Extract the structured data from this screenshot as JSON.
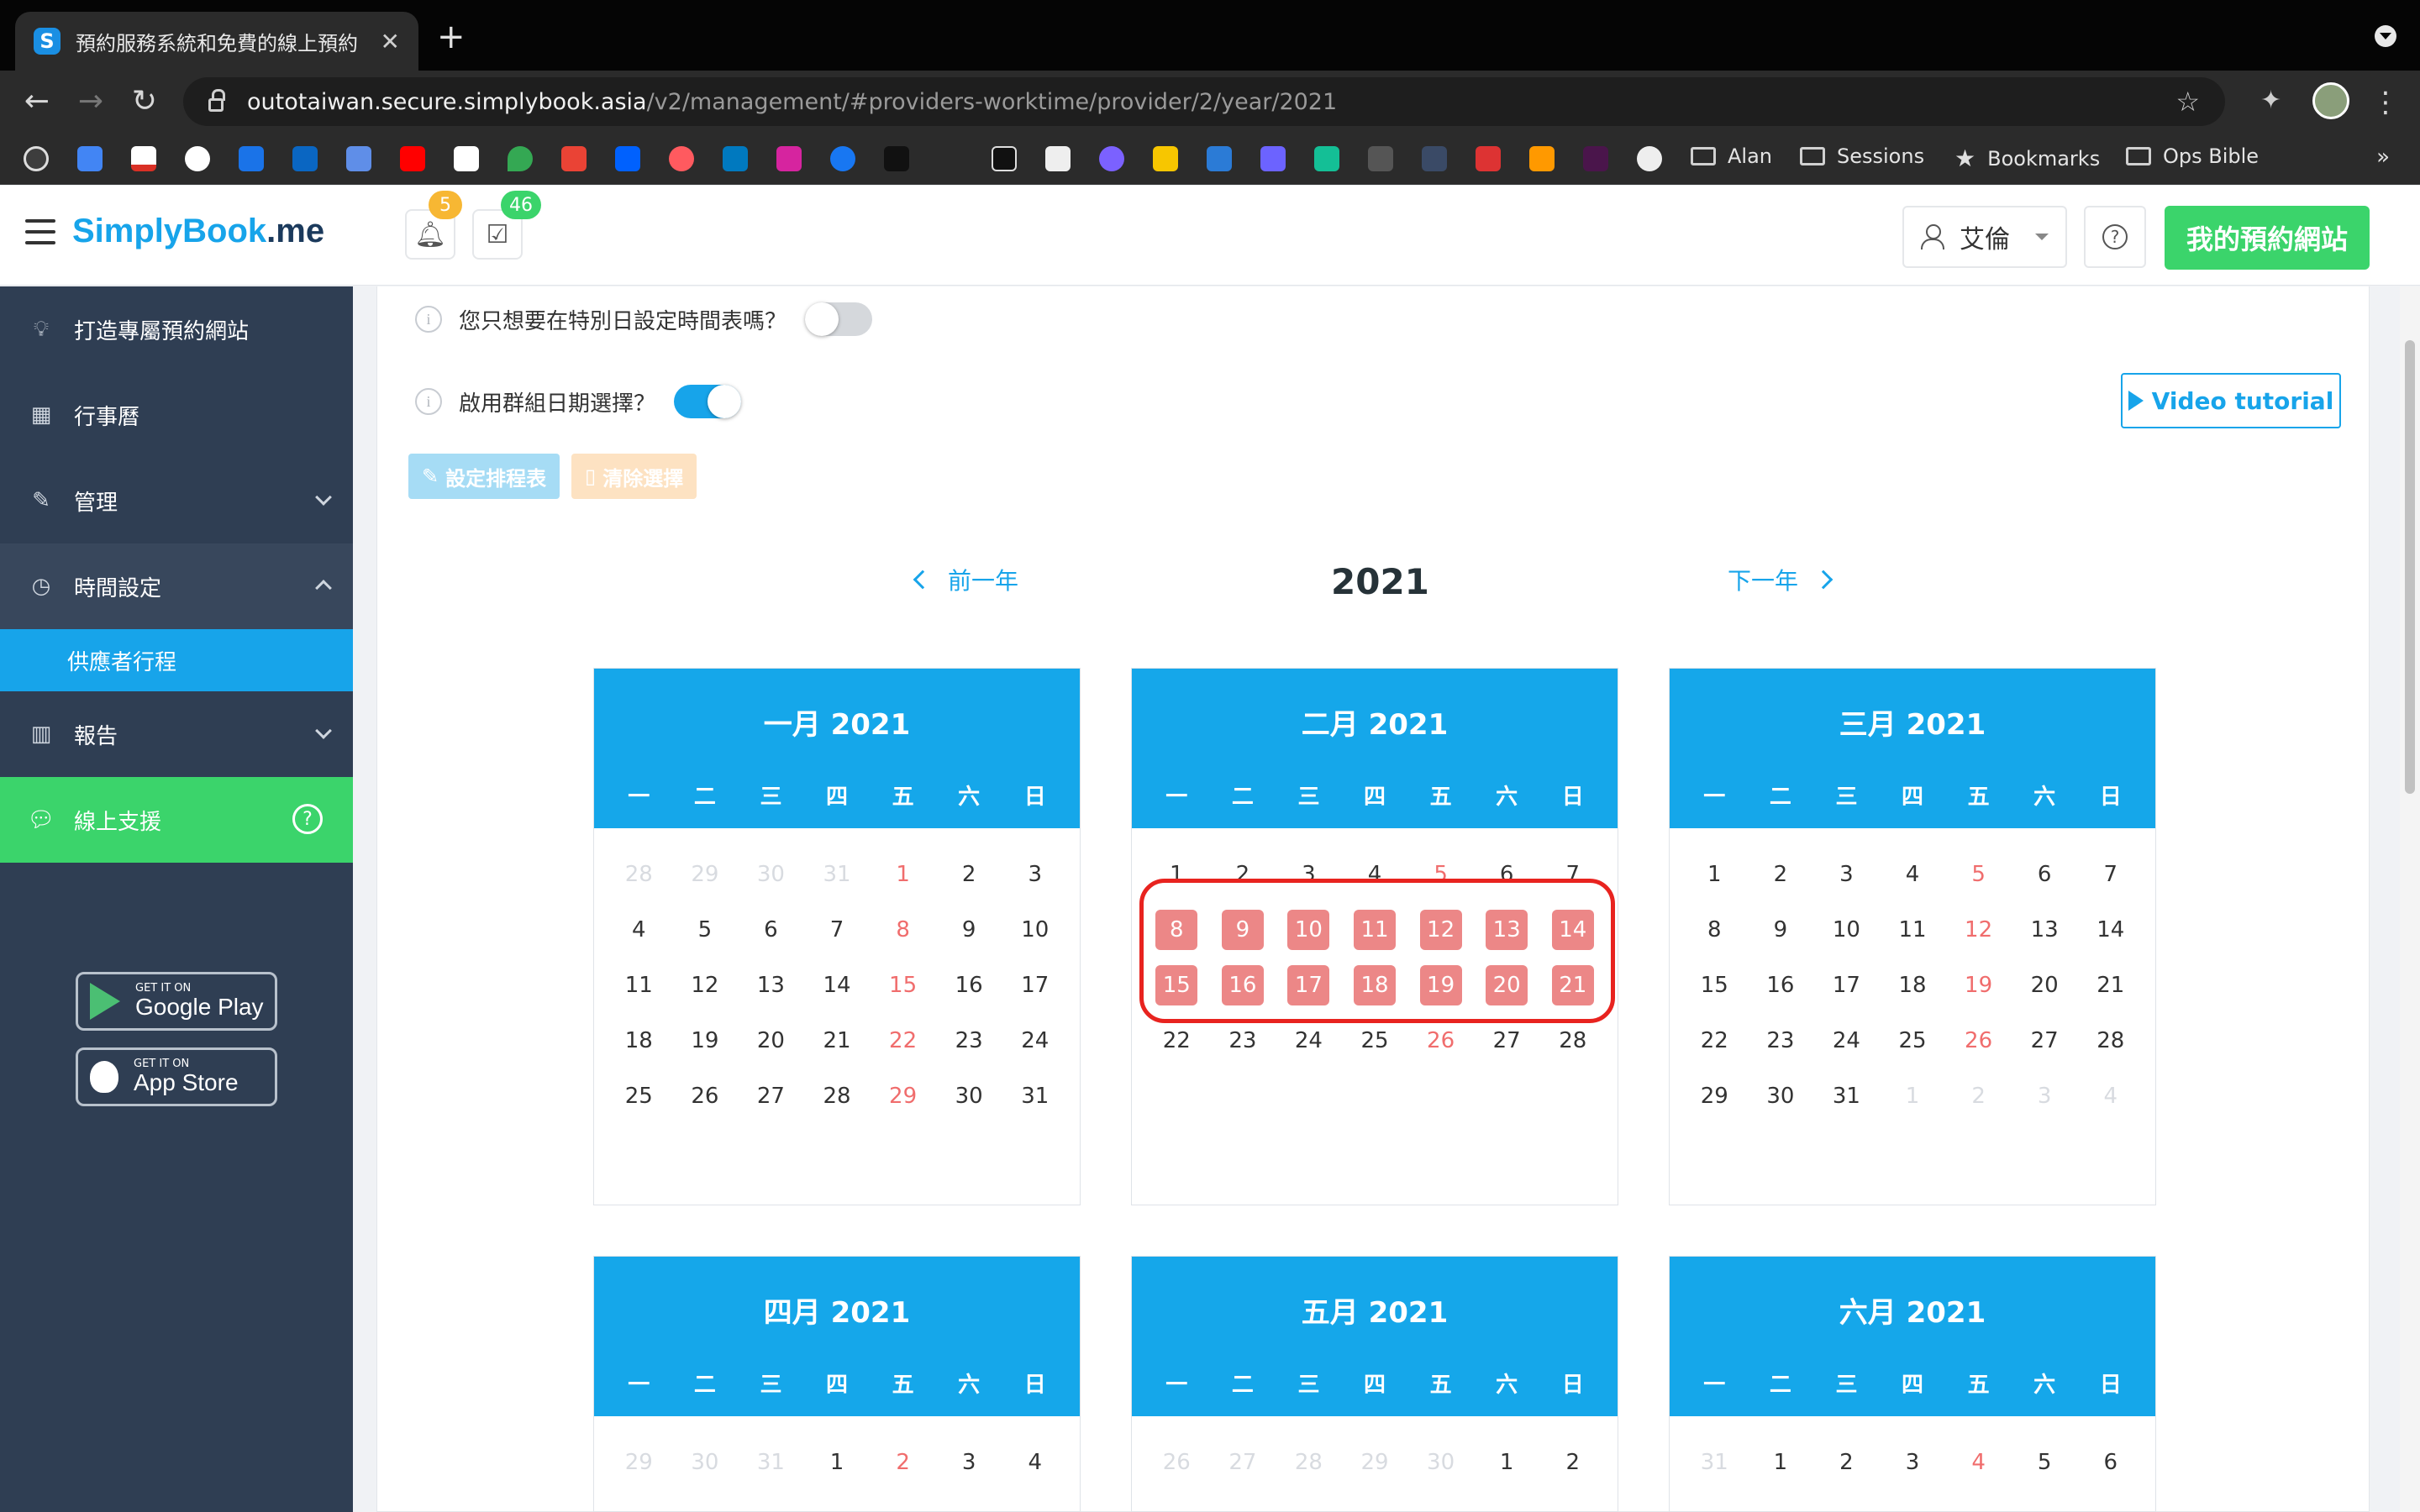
{
  "browser": {
    "tab_title": "預約服務系統和免費的線上預約",
    "url_host": "outotaiwan.secure.simplybook.asia",
    "url_path": "/v2/management/#providers-worktime/provider/2/year/2021",
    "bookmarks_folders": [
      "Alan",
      "Sessions",
      "Bookmarks",
      "Ops Bible"
    ],
    "bookmarks_more": "»"
  },
  "header": {
    "logo_prefix": "SimplyBook",
    "logo_suffix": ".me",
    "notif_count": "5",
    "tasks_count": "46",
    "user_name": "艾倫",
    "site_button": "我的預約網站"
  },
  "sidebar": {
    "items": [
      {
        "label": "打造專屬預約網站",
        "icon": "lightbulb-icon"
      },
      {
        "label": "行事曆",
        "icon": "calendar-icon"
      },
      {
        "label": "管理",
        "icon": "pencil-icon"
      },
      {
        "label": "時間設定",
        "icon": "clock-icon"
      },
      {
        "label": "報告",
        "icon": "bar-chart-icon"
      }
    ],
    "sub_item": "供應者行程",
    "support_label": "線上支援",
    "google_play_small": "GET IT ON",
    "google_play_big": "Google Play",
    "app_store_small": "GET IT ON",
    "app_store_big": "App Store"
  },
  "options": {
    "special_days_label": "您只想要在特別日設定時間表嗎？",
    "group_dates_label": "啟用群組日期選擇？",
    "set_schedule": "設定排程表",
    "clear_selection": "清除選擇",
    "video_tutorial": "Video tutorial"
  },
  "calendar": {
    "year": "2021",
    "prev_year": "前一年",
    "next_year": "下一年",
    "weekdays": [
      "一",
      "二",
      "三",
      "四",
      "五",
      "六",
      "日"
    ],
    "months": [
      {
        "title": "一月 2021",
        "weeks": [
          [
            28,
            29,
            30,
            31,
            1,
            2,
            3
          ],
          [
            4,
            5,
            6,
            7,
            8,
            9,
            10
          ],
          [
            11,
            12,
            13,
            14,
            15,
            16,
            17
          ],
          [
            18,
            19,
            20,
            21,
            22,
            23,
            24
          ],
          [
            25,
            26,
            27,
            28,
            29,
            30,
            31
          ]
        ],
        "leading_muted": 4,
        "trailing_muted": 0
      },
      {
        "title": "二月 2021",
        "weeks": [
          [
            1,
            2,
            3,
            4,
            5,
            6,
            7
          ],
          [
            8,
            9,
            10,
            11,
            12,
            13,
            14
          ],
          [
            15,
            16,
            17,
            18,
            19,
            20,
            21
          ],
          [
            22,
            23,
            24,
            25,
            26,
            27,
            28
          ]
        ],
        "leading_muted": 0,
        "trailing_muted": 0,
        "selected": [
          8,
          9,
          10,
          11,
          12,
          13,
          14,
          15,
          16,
          17,
          18,
          19,
          20,
          21
        ]
      },
      {
        "title": "三月 2021",
        "weeks": [
          [
            1,
            2,
            3,
            4,
            5,
            6,
            7
          ],
          [
            8,
            9,
            10,
            11,
            12,
            13,
            14
          ],
          [
            15,
            16,
            17,
            18,
            19,
            20,
            21
          ],
          [
            22,
            23,
            24,
            25,
            26,
            27,
            28
          ],
          [
            29,
            30,
            31,
            1,
            2,
            3,
            4
          ]
        ],
        "leading_muted": 0,
        "trailing_muted": 4
      },
      {
        "title": "四月 2021",
        "weeks": [
          [
            29,
            30,
            31,
            1,
            2,
            3,
            4
          ]
        ],
        "leading_muted": 3,
        "trailing_muted": 0
      },
      {
        "title": "五月 2021",
        "weeks": [
          [
            26,
            27,
            28,
            29,
            30,
            1,
            2
          ]
        ],
        "leading_muted": 5,
        "trailing_muted": 0
      },
      {
        "title": "六月 2021",
        "weeks": [
          [
            31,
            1,
            2,
            3,
            4,
            5,
            6
          ]
        ],
        "leading_muted": 1,
        "trailing_muted": 0
      }
    ]
  },
  "colors": {
    "accent": "#15a7ea",
    "success": "#3bd46b",
    "sidebar": "#2f3e53",
    "friday_red": "#f06d6d",
    "selected_day": "#ec8787",
    "highlight_outline": "#e8231f"
  }
}
